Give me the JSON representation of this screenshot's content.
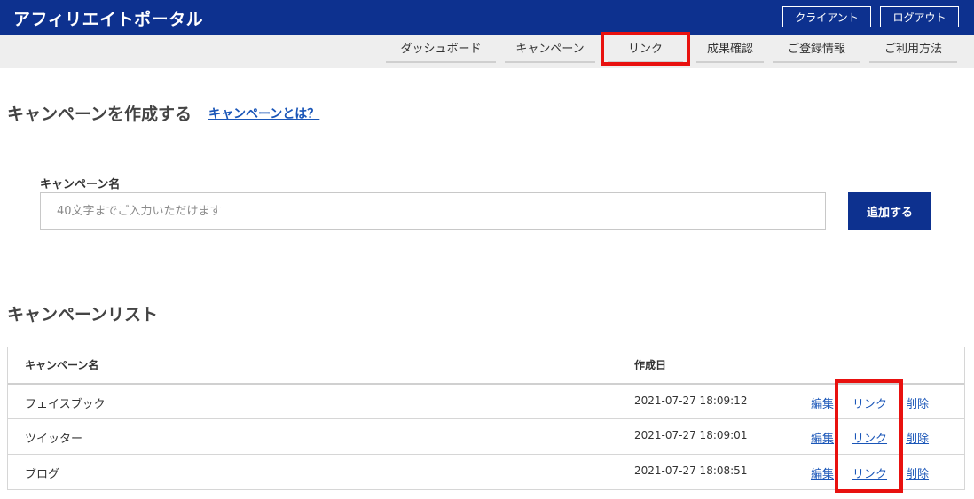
{
  "header": {
    "app_title": "アフィリエイトポータル",
    "client_button": "クライアント",
    "logout_button": "ログアウト",
    "color": "#0d318f"
  },
  "nav": {
    "items": [
      {
        "label": "ダッシュボード"
      },
      {
        "label": "キャンペーン"
      },
      {
        "label": "リンク",
        "highlighted": true
      },
      {
        "label": "成果確認"
      },
      {
        "label": "ご登録情報"
      },
      {
        "label": "ご利用方法"
      }
    ]
  },
  "create": {
    "title": "キャンペーンを作成する",
    "help_link": "キャンペーンとは？",
    "field_label": "キャンペーン名",
    "placeholder": "40文字までご入力いただけます",
    "value": "",
    "add_button": "追加する"
  },
  "list": {
    "title": "キャンペーンリスト",
    "columns": {
      "name": "キャンペーン名",
      "date": "作成日"
    },
    "rows": [
      {
        "name": "フェイスブック",
        "date": "2021-07-27 18:09:12",
        "edit": "編集",
        "link": "リンク",
        "delete": "削除"
      },
      {
        "name": "ツイッター",
        "date": "2021-07-27 18:09:01",
        "edit": "編集",
        "link": "リンク",
        "delete": "削除"
      },
      {
        "name": "ブログ",
        "date": "2021-07-27 18:08:51",
        "edit": "編集",
        "link": "リンク",
        "delete": "削除"
      }
    ]
  },
  "highlight_color": "#e8110f"
}
